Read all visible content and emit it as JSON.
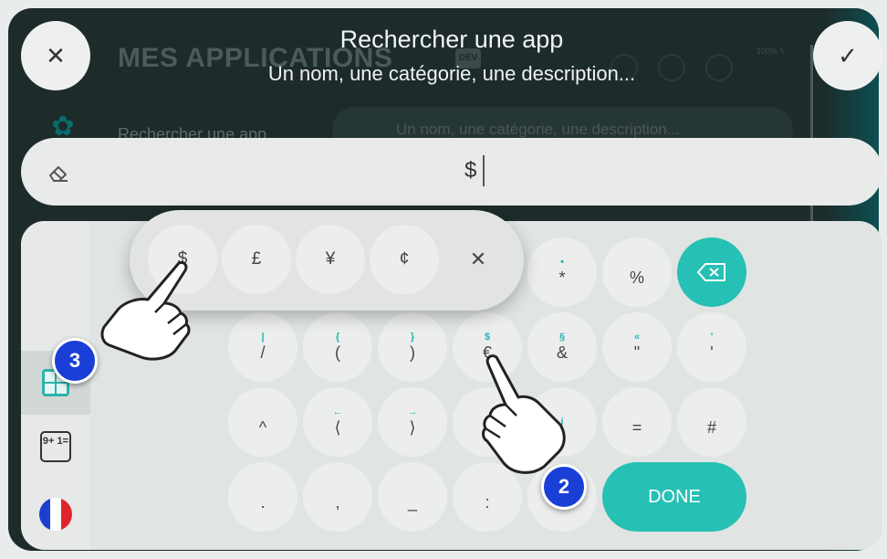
{
  "background_app": {
    "title": "MES APPLICATIONS",
    "dev_badge": "DEV",
    "battery_text": "100% ϟ",
    "search_label": "Rechercher une app",
    "search_placeholder": "Un nom, une catégorie, une description..."
  },
  "header": {
    "title": "Rechercher une app",
    "subtitle": "Un nom, une catégorie, une description..."
  },
  "buttons": {
    "close": "✕",
    "confirm": "✓"
  },
  "input": {
    "value": "$"
  },
  "popup": {
    "keys": [
      "$",
      "£",
      "¥",
      "¢"
    ],
    "close": "✕"
  },
  "keyboard": {
    "row1": [
      {
        "alt": "•",
        "main": "*"
      },
      {
        "alt": "",
        "main": "%"
      }
    ],
    "row2": [
      {
        "alt": "|",
        "main": "/"
      },
      {
        "alt": "{",
        "main": "("
      },
      {
        "alt": "}",
        "main": ")"
      },
      {
        "alt": "$",
        "main": "€"
      },
      {
        "alt": "§",
        "main": "&"
      },
      {
        "alt": "«",
        "main": "\""
      },
      {
        "alt": "'",
        "main": "'"
      }
    ],
    "row3": [
      {
        "alt": "",
        "main": "^"
      },
      {
        "alt": "←",
        "main": "⟨"
      },
      {
        "alt": "→",
        "main": "⟩"
      },
      {
        "alt": "i",
        "main": ""
      },
      {
        "alt": "",
        "main": "="
      },
      {
        "alt": "",
        "main": "#"
      }
    ],
    "row4": [
      {
        "alt": "",
        "main": "."
      },
      {
        "alt": "",
        "main": ","
      },
      {
        "alt": "",
        "main": "_"
      },
      {
        "alt": "",
        "main": ":"
      }
    ],
    "done_label": "DONE"
  },
  "rail": {
    "calc_icon": "9+ 1="
  },
  "annotations": {
    "step_a": "3",
    "step_b": "2"
  },
  "colors": {
    "accent": "#27c0b4",
    "badge": "#1a3fd6",
    "flag_blue": "#1c3fd0",
    "flag_red": "#e0242b"
  }
}
